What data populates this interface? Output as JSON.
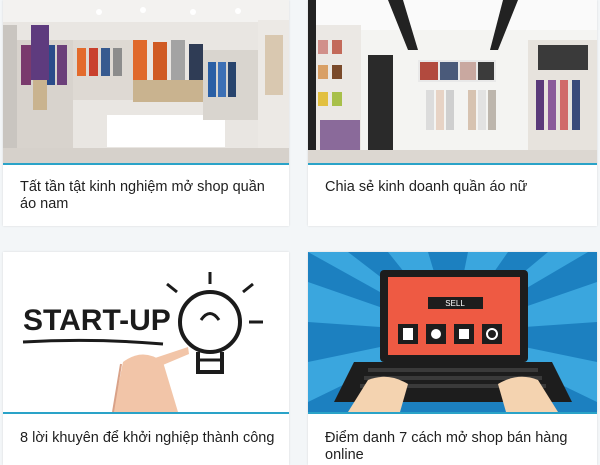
{
  "articles": [
    {
      "title": "Tất tần tật kinh nghiệm mở shop quần áo nam",
      "image": "menswear-store-photo"
    },
    {
      "title": "Chia sẻ kinh doanh quần áo nữ",
      "image": "womenswear-store-photo"
    },
    {
      "title": "8 lời khuyên để khởi nghiệp thành công",
      "image": "startup-lightbulb-drawing"
    },
    {
      "title": "Điểm danh 7 cách mở shop bán hàng online",
      "image": "laptop-online-shop-illustration"
    }
  ],
  "illustrations": {
    "startup_text": "START-UP",
    "sell_text": "SELL"
  },
  "colors": {
    "accent": "#2aa3c8",
    "laptop_screen": "#ee5a43",
    "rays_dark": "#1c80c0",
    "rays_light": "#3aa6de"
  }
}
